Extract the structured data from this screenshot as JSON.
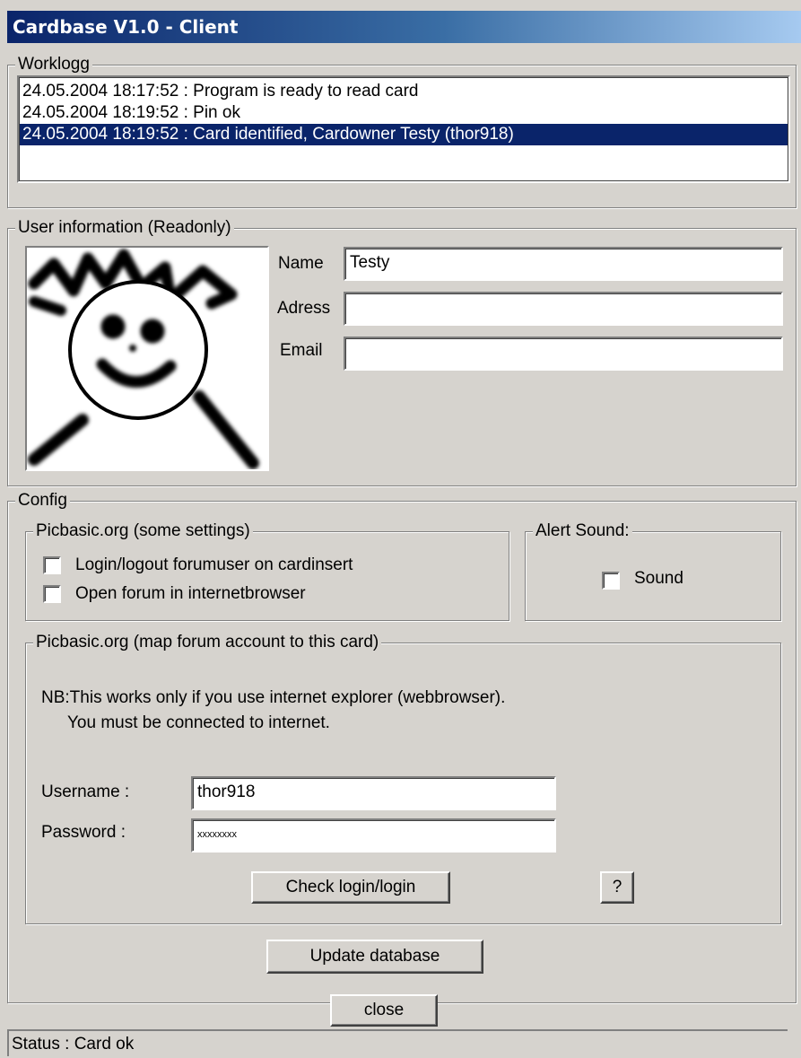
{
  "window": {
    "title": "Cardbase V1.0 - Client"
  },
  "worklog": {
    "legend": "Worklogg",
    "entries": [
      "24.05.2004 18:17:52 : Program is ready to read card",
      "24.05.2004 18:19:52 : Pin ok",
      "24.05.2004 18:19:52 : Card identified, Cardowner Testy (thor918)"
    ]
  },
  "user": {
    "legend": "User information (Readonly)",
    "name_label": "Name",
    "name_value": "Testy",
    "adress_label": "Adress",
    "adress_value": "",
    "email_label": "Email",
    "email_value": ""
  },
  "config": {
    "legend": "Config",
    "picbasic_settings": {
      "legend": "Picbasic.org (some settings)",
      "login_logout_label": "Login/logout forumuser on cardinsert",
      "login_logout_checked": false,
      "open_forum_label": "Open forum in internetbrowser",
      "open_forum_checked": false
    },
    "alert": {
      "legend": "Alert Sound:",
      "sound_label": "Sound",
      "sound_checked": false
    },
    "map_account": {
      "legend": "Picbasic.org (map forum account to this card)",
      "note_line1": "NB:This works only if you use internet explorer (webbrowser).",
      "note_line2": "You must be connected to internet.",
      "username_label": "Username :",
      "username_value": "thor918",
      "password_label": "Password :",
      "password_value": "xxxxxxxx",
      "check_button": "Check login/login",
      "help_button": "?"
    },
    "update_button": "Update database"
  },
  "close_button": "close",
  "status": {
    "text": "Status : Card ok"
  }
}
